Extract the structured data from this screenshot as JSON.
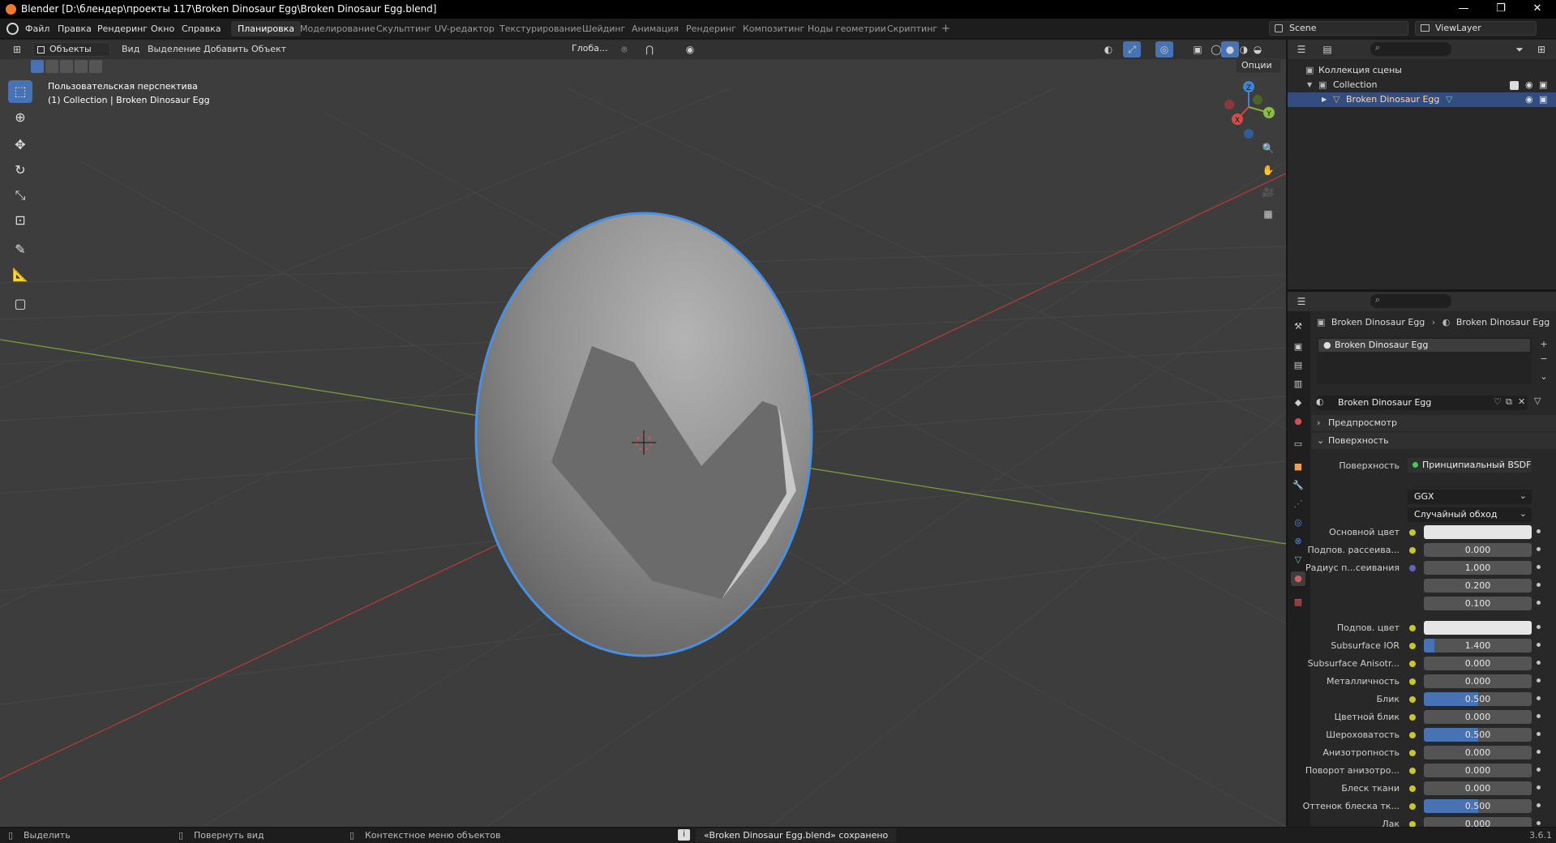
{
  "window": {
    "title": "Blender [D:\\блендер\\проекты 117\\Broken Dinosaur Egg\\Broken Dinosaur Egg.blend]",
    "minimize": "—",
    "maximize": "❐",
    "close": "✕"
  },
  "menu": [
    "Файл",
    "Правка",
    "Рендеринг",
    "Окно",
    "Справка"
  ],
  "workspaces": [
    "Планировка",
    "Моделирование",
    "Скульптинг",
    "UV-редактор",
    "Текстурирование",
    "Шейдинг",
    "Анимация",
    "Рендеринг",
    "Композитинг",
    "Ноды геометрии",
    "Скриптинг"
  ],
  "workspace_add": "+",
  "scene": {
    "name": "Scene",
    "view_layer": "ViewLayer"
  },
  "viewport": {
    "mode": "Объекты",
    "menus": [
      "Вид",
      "Выделение",
      "Добавить",
      "Объект"
    ],
    "transform_orientation": "Глоба...",
    "options": "Опции",
    "perspective_label": "Пользовательская перспектива",
    "collection_label": "(1) Collection | Broken Dinosaur Egg",
    "gizmo": {
      "x": "X",
      "y": "Y",
      "z": "Z"
    }
  },
  "outliner": {
    "root": "Коллекция сцены",
    "collection": "Collection",
    "object": "Broken Dinosaur Egg"
  },
  "properties": {
    "breadcrumb_object": "Broken Dinosaur Egg",
    "breadcrumb_material": "Broken Dinosaur Egg",
    "slot_name": "Broken Dinosaur Egg",
    "material_name": "Broken Dinosaur Egg",
    "panel_preview": "Предпросмотр",
    "panel_surface": "Поверхность",
    "surface_label": "Поверхность",
    "surface_value": "Принципиальный BSDF",
    "distribution": "GGX",
    "subsurface_method": "Случайный обход",
    "rows": [
      {
        "label": "Основной цвет",
        "type": "color",
        "color": "#e6e6e6"
      },
      {
        "label": "Подпов. рассеива...",
        "value": "0.000",
        "fill": 0
      },
      {
        "label": "Радиус п...сеивания",
        "value": "1.000",
        "fill": 0,
        "dot_color": "#6363c7"
      },
      {
        "label": "",
        "value": "0.200",
        "fill": 0,
        "nodot": true
      },
      {
        "label": "",
        "value": "0.100",
        "fill": 0,
        "nodot": true
      },
      {
        "label": "Подпов. цвет",
        "type": "color",
        "color": "#e6e6e6"
      },
      {
        "label": "Subsurface IOR",
        "value": "1.400",
        "fill": 0.1
      },
      {
        "label": "Subsurface Anisotr...",
        "value": "0.000",
        "fill": 0
      },
      {
        "label": "Металличность",
        "value": "0.000",
        "fill": 0
      },
      {
        "label": "Блик",
        "value": "0.500",
        "fill": 0.5
      },
      {
        "label": "Цветной блик",
        "value": "0.000",
        "fill": 0
      },
      {
        "label": "Шероховатость",
        "value": "0.500",
        "fill": 0.5
      },
      {
        "label": "Анизотропность",
        "value": "0.000",
        "fill": 0
      },
      {
        "label": "Поворот анизотро...",
        "value": "0.000",
        "fill": 0
      },
      {
        "label": "Блеск ткани",
        "value": "0.000",
        "fill": 0
      },
      {
        "label": "Оттенок блеска тк...",
        "value": "0.500",
        "fill": 0.5
      },
      {
        "label": "Лак",
        "value": "0.000",
        "fill": 0
      }
    ]
  },
  "statusbar": {
    "select": "Выделить",
    "rotate": "Повернуть вид",
    "context_menu": "Контекстное меню объектов",
    "message": "«Broken Dinosaur Egg.blend» сохранено",
    "version": "3.6.1"
  },
  "colors": {
    "accent": "#4772b3",
    "selection_outline": "#4a90e2",
    "background": "#1d1d1d",
    "viewport": "#3d3d3d"
  }
}
